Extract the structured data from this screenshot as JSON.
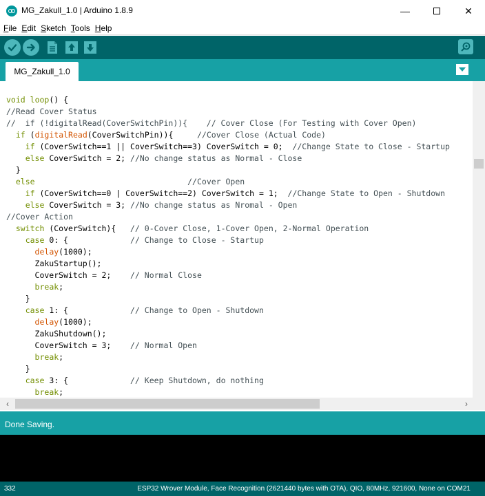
{
  "window": {
    "title": "MG_Zakull_1.0 | Arduino 1.8.9",
    "minimize": "—",
    "close": "✕"
  },
  "menu": [
    {
      "u": "F",
      "rest": "ile"
    },
    {
      "u": "E",
      "rest": "dit"
    },
    {
      "u": "S",
      "rest": "ketch"
    },
    {
      "u": "T",
      "rest": "ools"
    },
    {
      "u": "H",
      "rest": "elp"
    }
  ],
  "toolbar": {
    "icons": [
      "verify-icon",
      "upload-icon",
      "new-icon",
      "open-icon",
      "save-icon",
      "serial-monitor-icon"
    ]
  },
  "tab": {
    "label": "MG_Zakull_1.0"
  },
  "code_lines": [
    [
      {
        "t": "void",
        "c": "kw"
      },
      {
        "t": " "
      },
      {
        "t": "loop",
        "c": "kw"
      },
      {
        "t": "() {"
      }
    ],
    [
      {
        "t": "//Read Cover Status",
        "c": "cm"
      }
    ],
    [
      {
        "t": "//  if (!digitalRead(CoverSwitchPin)){    // Cover Close (For Testing with Cover Open)",
        "c": "cm"
      }
    ],
    [
      {
        "t": "  "
      },
      {
        "t": "if",
        "c": "kw"
      },
      {
        "t": " ("
      },
      {
        "t": "digitalRead",
        "c": "fn"
      },
      {
        "t": "(CoverSwitchPin)){     "
      },
      {
        "t": "//Cover Close (Actual Code)",
        "c": "cm"
      }
    ],
    [
      {
        "t": "    "
      },
      {
        "t": "if",
        "c": "kw"
      },
      {
        "t": " (CoverSwitch==1 || CoverSwitch==3) CoverSwitch = 0;  "
      },
      {
        "t": "//Change State to Close - Startup",
        "c": "cm"
      }
    ],
    [
      {
        "t": "    "
      },
      {
        "t": "else",
        "c": "kw"
      },
      {
        "t": " CoverSwitch = 2; "
      },
      {
        "t": "//No change status as Normal - Close",
        "c": "cm"
      }
    ],
    [
      {
        "t": "  }"
      }
    ],
    [
      {
        "t": "  "
      },
      {
        "t": "else",
        "c": "kw"
      },
      {
        "t": "                                "
      },
      {
        "t": "//Cover Open",
        "c": "cm"
      }
    ],
    [
      {
        "t": "    "
      },
      {
        "t": "if",
        "c": "kw"
      },
      {
        "t": " (CoverSwitch==0 | CoverSwitch==2) CoverSwitch = 1;  "
      },
      {
        "t": "//Change State to Open - Shutdown",
        "c": "cm"
      }
    ],
    [
      {
        "t": "    "
      },
      {
        "t": "else",
        "c": "kw"
      },
      {
        "t": " CoverSwitch = 3; "
      },
      {
        "t": "//No change status as Nromal - Open",
        "c": "cm"
      }
    ],
    [
      {
        "t": "//Cover Action",
        "c": "cm"
      }
    ],
    [
      {
        "t": "  "
      },
      {
        "t": "switch",
        "c": "kw"
      },
      {
        "t": " (CoverSwitch){   "
      },
      {
        "t": "// 0-Cover Close, 1-Cover Open, 2-Normal Operation",
        "c": "cm"
      }
    ],
    [
      {
        "t": "    "
      },
      {
        "t": "case",
        "c": "kw"
      },
      {
        "t": " 0: {             "
      },
      {
        "t": "// Change to Close - Startup",
        "c": "cm"
      }
    ],
    [
      {
        "t": "      "
      },
      {
        "t": "delay",
        "c": "fn"
      },
      {
        "t": "(1000);"
      }
    ],
    [
      {
        "t": "      ZakuStartup();"
      }
    ],
    [
      {
        "t": "      CoverSwitch = 2;    "
      },
      {
        "t": "// Normal Close",
        "c": "cm"
      }
    ],
    [
      {
        "t": "      "
      },
      {
        "t": "break",
        "c": "kw"
      },
      {
        "t": ";"
      }
    ],
    [
      {
        "t": "    }"
      }
    ],
    [
      {
        "t": "    "
      },
      {
        "t": "case",
        "c": "kw"
      },
      {
        "t": " 1: {             "
      },
      {
        "t": "// Change to Open - Shutdown",
        "c": "cm"
      }
    ],
    [
      {
        "t": "      "
      },
      {
        "t": "delay",
        "c": "fn"
      },
      {
        "t": "(1000);"
      }
    ],
    [
      {
        "t": "      ZakuShutdown();"
      }
    ],
    [
      {
        "t": "      CoverSwitch = 3;    "
      },
      {
        "t": "// Normal Open",
        "c": "cm"
      }
    ],
    [
      {
        "t": "      "
      },
      {
        "t": "break",
        "c": "kw"
      },
      {
        "t": ";"
      }
    ],
    [
      {
        "t": "    }"
      }
    ],
    [
      {
        "t": "    "
      },
      {
        "t": "case",
        "c": "kw"
      },
      {
        "t": " 3: {             "
      },
      {
        "t": "// Keep Shutdown, do nothing",
        "c": "cm"
      }
    ],
    [
      {
        "t": "      "
      },
      {
        "t": "break",
        "c": "kw"
      },
      {
        "t": ";"
      }
    ]
  ],
  "scroll": {
    "left_arrow": "‹",
    "right_arrow": "›"
  },
  "status": {
    "message": "Done Saving."
  },
  "bottom": {
    "line_number": "332",
    "board_info": "ESP32 Wrover Module, Face Recognition (2621440 bytes with OTA), QIO, 80MHz, 921600, None on COM21"
  },
  "colors": {
    "toolbar": "#006468",
    "tabstrip": "#17a1a5",
    "keyword": "#728e00",
    "comment": "#434f54",
    "function": "#d35400"
  }
}
